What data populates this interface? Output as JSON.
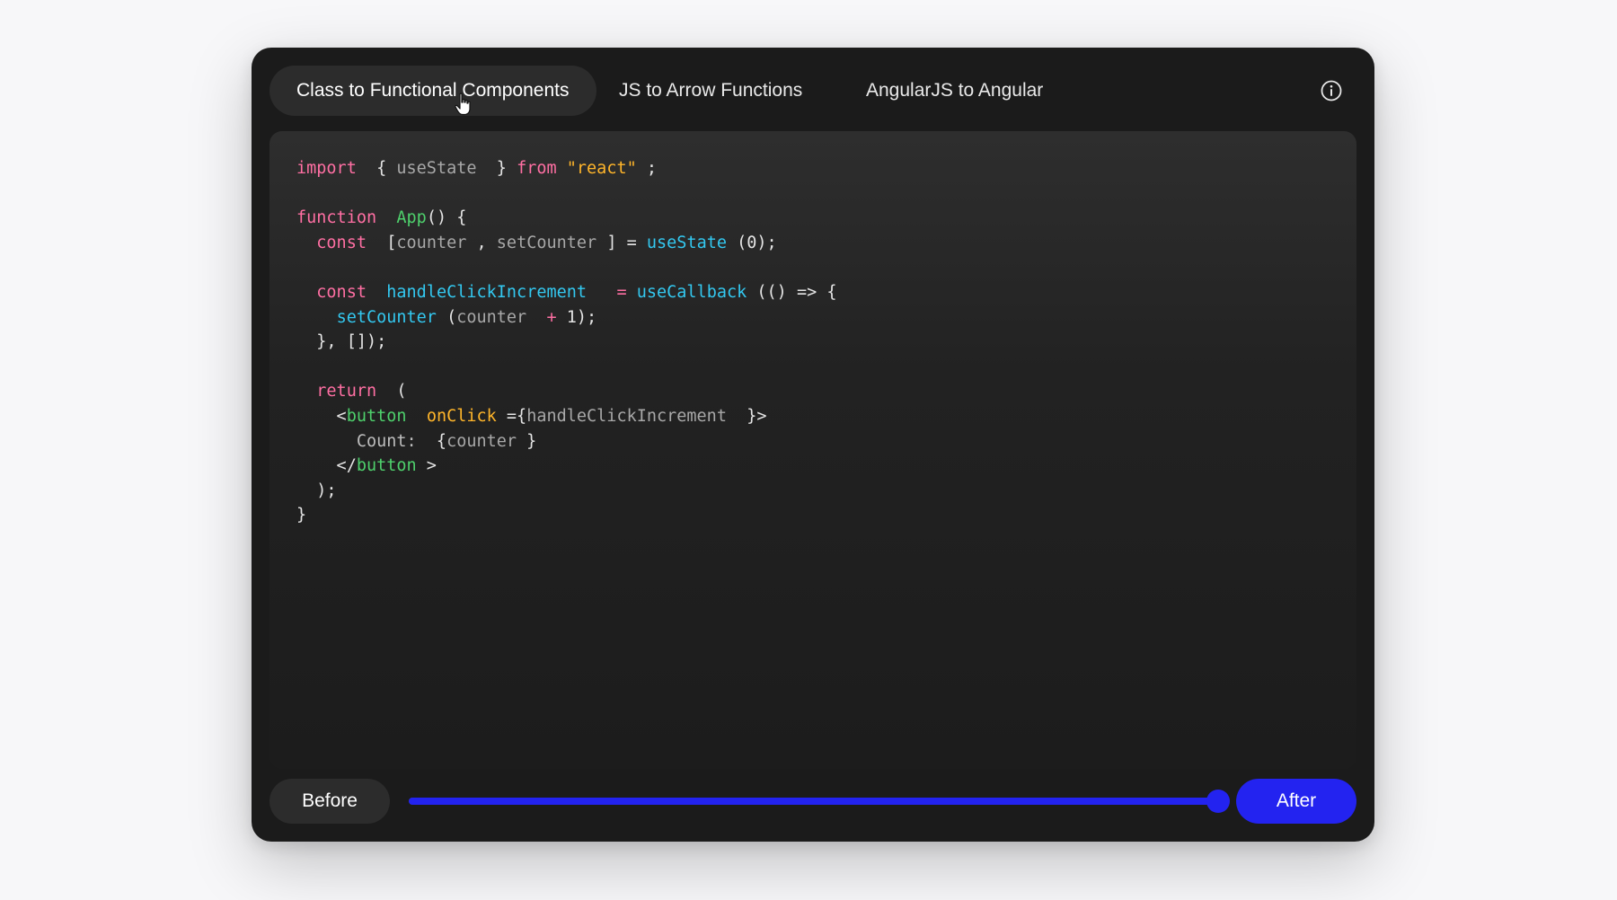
{
  "tabs": [
    {
      "label": "Class to Functional Components",
      "active": true
    },
    {
      "label": "JS to Arrow Functions",
      "active": false
    },
    {
      "label": "AngularJS to Angular",
      "active": false
    }
  ],
  "info_icon": "info-icon",
  "code_lines": [
    [
      [
        "keyword",
        "import"
      ],
      [
        "punct",
        "  { "
      ],
      [
        "ident",
        "useState"
      ],
      [
        "punct",
        "  } "
      ],
      [
        "keyword",
        "from"
      ],
      [
        "punct",
        " "
      ],
      [
        "string",
        "\"react\""
      ],
      [
        "punct",
        " ;"
      ]
    ],
    [],
    [
      [
        "keyword",
        "function"
      ],
      [
        "punct",
        "  "
      ],
      [
        "func",
        "App"
      ],
      [
        "punct",
        "() {"
      ]
    ],
    [
      [
        "punct",
        "  "
      ],
      [
        "keyword",
        "const"
      ],
      [
        "punct",
        "  ["
      ],
      [
        "ident",
        "counter"
      ],
      [
        "punct",
        " , "
      ],
      [
        "ident",
        "setCounter"
      ],
      [
        "punct",
        " ] = "
      ],
      [
        "call",
        "useState"
      ],
      [
        "punct",
        " ("
      ],
      [
        "number",
        "0"
      ],
      [
        "punct",
        ");"
      ]
    ],
    [],
    [
      [
        "punct",
        "  "
      ],
      [
        "keyword",
        "const"
      ],
      [
        "punct",
        "  "
      ],
      [
        "call",
        "handleClickIncrement"
      ],
      [
        "punct",
        "   "
      ],
      [
        "op",
        "="
      ],
      [
        "punct",
        " "
      ],
      [
        "call",
        "useCallback"
      ],
      [
        "punct",
        " (() => {"
      ]
    ],
    [
      [
        "punct",
        "    "
      ],
      [
        "call",
        "set"
      ],
      [
        "call",
        "Counter"
      ],
      [
        "punct",
        " ("
      ],
      [
        "ident",
        "counter"
      ],
      [
        "punct",
        "  "
      ],
      [
        "op",
        "+"
      ],
      [
        "punct",
        " "
      ],
      [
        "number",
        "1"
      ],
      [
        "punct",
        ");"
      ]
    ],
    [
      [
        "punct",
        "  }, []);"
      ]
    ],
    [],
    [
      [
        "punct",
        "  "
      ],
      [
        "keyword",
        "return"
      ],
      [
        "punct",
        "  ("
      ]
    ],
    [
      [
        "punct",
        "    <"
      ],
      [
        "tag",
        "button"
      ],
      [
        "punct",
        "  "
      ],
      [
        "attr",
        "onClick"
      ],
      [
        "punct",
        " ={"
      ],
      [
        "ident",
        "handleClickIncrement"
      ],
      [
        "punct",
        "  }>"
      ]
    ],
    [
      [
        "punct",
        "      "
      ],
      [
        "text",
        "Count:"
      ],
      [
        "punct",
        "  {"
      ],
      [
        "ident",
        "counter"
      ],
      [
        "punct",
        " }"
      ]
    ],
    [
      [
        "punct",
        "    </"
      ],
      [
        "tag",
        "button"
      ],
      [
        "punct",
        " >"
      ]
    ],
    [
      [
        "punct",
        "  );"
      ]
    ],
    [
      [
        "punct",
        "}"
      ]
    ]
  ],
  "bottom": {
    "before_label": "Before",
    "after_label": "After",
    "slider_value": 1.0
  },
  "colors": {
    "accent": "#2323f0",
    "panel_bg": "#1b1b1b",
    "keyword": "#ff6fa3",
    "function": "#4ed06c",
    "call": "#33c8f0",
    "string": "#ffb52a"
  }
}
